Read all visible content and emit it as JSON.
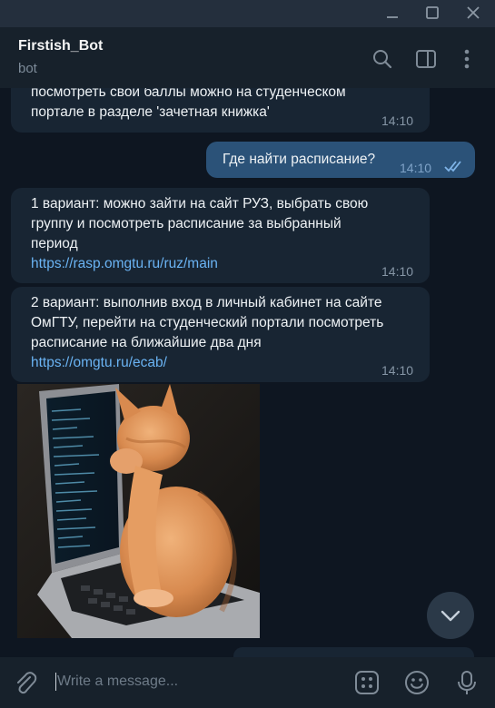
{
  "window": {
    "controls": [
      "minimize-icon",
      "maximize-icon",
      "close-icon"
    ]
  },
  "header": {
    "title": "Firstish_Bot",
    "subtitle": "bot",
    "icons": [
      "search-icon",
      "sidebar-toggle-icon",
      "more-vertical-icon"
    ]
  },
  "messages": [
    {
      "direction": "in",
      "lines": [
        "посмотреть свои баллы можно на студенческом",
        "портале в разделе 'зачетная книжка'"
      ],
      "time": "14:10"
    },
    {
      "direction": "out",
      "text": "Где найти расписание?",
      "time": "14:10",
      "status_icon": "double-check-icon"
    },
    {
      "direction": "in",
      "lines": [
        "1 вариант: можно зайти на сайт РУЗ, выбрать свою",
        "группу и посмотреть расписание за выбранный",
        "период"
      ],
      "link": "https://rasp.omgtu.ru/ruz/main",
      "time": "14:10"
    },
    {
      "direction": "in",
      "lines": [
        "2 вариант: выполнив вход в личный кабинет на сайте",
        "ОмГТУ, перейти на студенческий портали посмотреть",
        "расписание на ближайшие два дня"
      ],
      "link": "https://omgtu.ru/ecab/",
      "time": "14:10"
    },
    {
      "direction": "in",
      "type": "animation",
      "media": "cat-on-laptop-gif"
    }
  ],
  "scroll_button": {
    "icon": "chevron-down-icon"
  },
  "composer": {
    "placeholder": "Write a message...",
    "icons": [
      "attach-icon",
      "bot-commands-icon",
      "emoji-icon",
      "microphone-icon"
    ]
  },
  "colors": {
    "chat_bg": "#0e1621",
    "header_bg": "#17212b",
    "incoming_bubble": "#182533",
    "outgoing_bubble": "#2b5278",
    "link": "#6ab3f3",
    "meta_text": "#8696a6"
  }
}
